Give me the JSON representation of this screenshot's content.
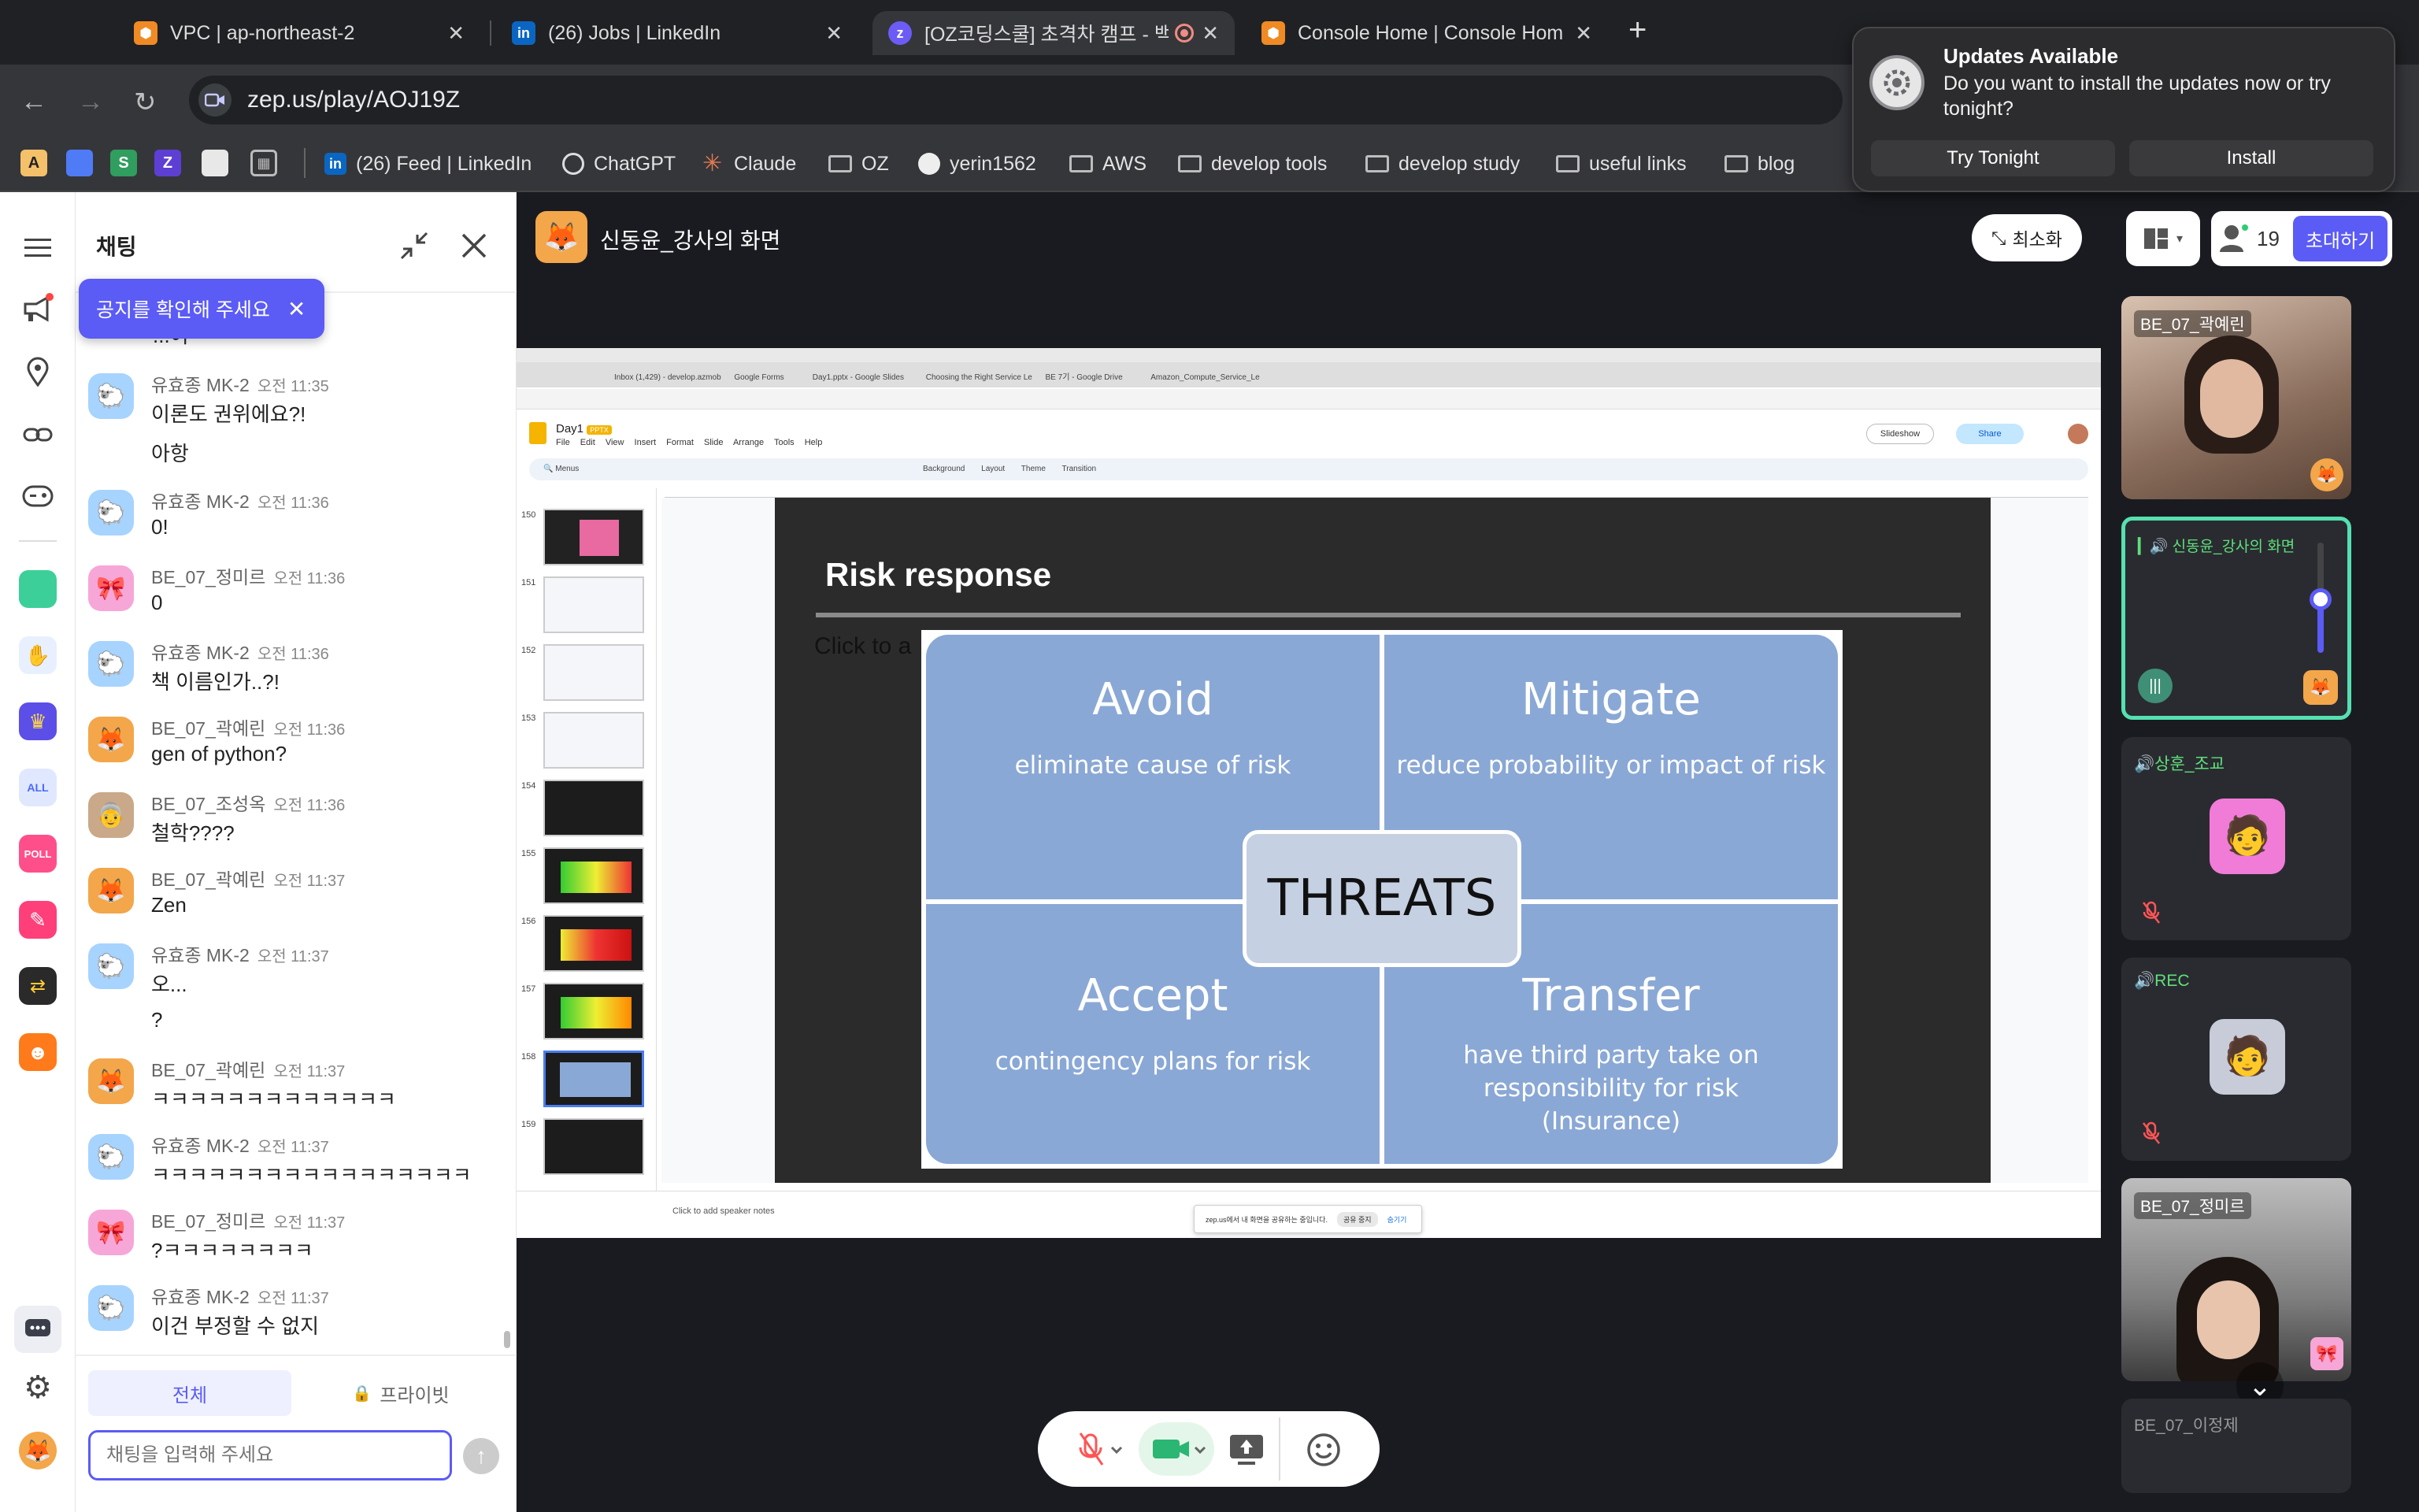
{
  "browser": {
    "tabs": [
      {
        "title": "VPC | ap-northeast-2",
        "icon": "aws-icon"
      },
      {
        "title": "(26) Jobs | LinkedIn",
        "icon": "linkedin-icon"
      },
      {
        "title": "[OZ코딩스쿨] 초격차 캠프 - 백",
        "icon": "zep-icon"
      },
      {
        "title": "Console Home | Console Hom",
        "icon": "aws-icon"
      }
    ],
    "url": "zep.us/play/AOJ19Z",
    "bookmarks": [
      "(26) Feed | LinkedIn",
      "ChatGPT",
      "Claude",
      "OZ",
      "yerin1562",
      "AWS",
      "develop tools",
      "develop study",
      "useful links",
      "blog"
    ],
    "bookmark_letters": [
      "A",
      "S",
      "Z"
    ]
  },
  "notification": {
    "title": "Updates Available",
    "body": "Do you want to install the updates now or try tonight?",
    "later": "Try Tonight",
    "install": "Install"
  },
  "chat": {
    "title": "채팅",
    "notice": "공지를 확인해 주세요",
    "partial_text": "...어",
    "messages": [
      {
        "name": "유효종 MK-2",
        "time": "오전 11:35",
        "lines": [
          "이론도 권위에요?!",
          "아항"
        ]
      },
      {
        "name": "유효종 MK-2",
        "time": "오전 11:36",
        "lines": [
          "0!"
        ]
      },
      {
        "name": "BE_07_정미르",
        "time": "오전 11:36",
        "lines": [
          "0"
        ]
      },
      {
        "name": "유효종 MK-2",
        "time": "오전 11:36",
        "lines": [
          "책 이름인가..?!"
        ]
      },
      {
        "name": "BE_07_곽예린",
        "time": "오전 11:36",
        "lines": [
          "gen of python?"
        ]
      },
      {
        "name": "BE_07_조성옥",
        "time": "오전 11:36",
        "lines": [
          "철학????"
        ]
      },
      {
        "name": "BE_07_곽예린",
        "time": "오전 11:37",
        "lines": [
          "Zen"
        ]
      },
      {
        "name": "유효종 MK-2",
        "time": "오전 11:37",
        "lines": [
          "오...",
          "?"
        ]
      },
      {
        "name": "BE_07_곽예린",
        "time": "오전 11:37",
        "lines": [
          "ㅋㅋㅋㅋㅋㅋㅋㅋㅋㅋㅋㅋㅋ"
        ]
      },
      {
        "name": "유효종 MK-2",
        "time": "오전 11:37",
        "lines": [
          "ㅋㅋㅋㅋㅋㅋㅋㅋㅋㅋㅋㅋㅋㅋㅋㅋㅋ"
        ]
      },
      {
        "name": "BE_07_정미르",
        "time": "오전 11:37",
        "lines": [
          "?ㅋㅋㅋㅋㅋㅋㅋㅋ"
        ]
      },
      {
        "name": "유효종 MK-2",
        "time": "오전 11:37",
        "lines": [
          "이건 부정할 수 없지"
        ]
      }
    ],
    "tab_all": "전체",
    "tab_private": "프라이빗",
    "input_placeholder": "채팅을 입력해 주세요"
  },
  "screen": {
    "presenter": "신동윤_강사의 화면",
    "minimize": "최소화",
    "participants": "19",
    "invite": "초대하기"
  },
  "slides_app": {
    "doc_title": "Day1",
    "badge": "PPTX",
    "menus": [
      "File",
      "Edit",
      "View",
      "Insert",
      "Format",
      "Slide",
      "Arrange",
      "Tools",
      "Help"
    ],
    "toolbar": [
      "Menus",
      "Background",
      "Layout",
      "Theme",
      "Transition"
    ],
    "slideshow": "Slideshow",
    "share": "Share",
    "notes": "Click to add speaker notes",
    "share_banner": "zep.us에서 내 화면을 공유하는 중입니다.",
    "share_stop": "공유 중지",
    "share_hide": "숨기기",
    "thumb_numbers": [
      "150",
      "151",
      "152",
      "153",
      "154",
      "155",
      "156",
      "157",
      "158",
      "159"
    ],
    "tabs": [
      "Inbox (1,429) - develop.azmob",
      "Google Forms",
      "Day1.pptx - Google Slides",
      "Choosing the Right Service Le",
      "BE 7기 - Google Drive",
      "Amazon_Compute_Service_Le"
    ]
  },
  "slide": {
    "title": "Risk response",
    "placeholder": "Click to a",
    "center": "THREATS",
    "quadrants": [
      {
        "head": "Avoid",
        "sub": "eliminate cause of risk"
      },
      {
        "head": "Mitigate",
        "sub": "reduce probability or impact of risk"
      },
      {
        "head": "Accept",
        "sub": "contingency plans for risk"
      },
      {
        "head": "Transfer",
        "sub": "have third party take on responsibility for risk (Insurance)"
      }
    ]
  },
  "videos": [
    {
      "name": "BE_07_곽예린"
    },
    {
      "name": "신동윤_강사의 화면"
    },
    {
      "name": "상훈_조교"
    },
    {
      "name": "REC"
    },
    {
      "name": "BE_07_정미르"
    },
    {
      "name": "BE_07_이정제"
    }
  ],
  "colors": {
    "accent": "#5b5bf6",
    "tile": "#2a2b31",
    "quad": "#8aa8d5",
    "active_border": "#55e0b0"
  }
}
